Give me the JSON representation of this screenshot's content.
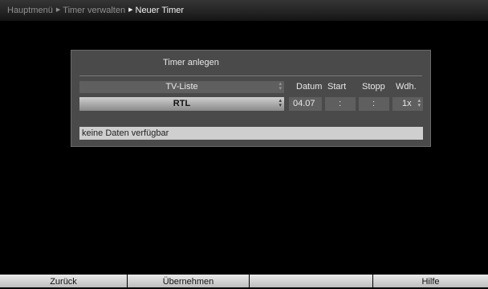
{
  "breadcrumb": {
    "items": [
      "Hauptmenü",
      "Timer verwalten",
      "Neuer Timer"
    ],
    "separator": "▶"
  },
  "dialog": {
    "title": "Timer anlegen",
    "list_label": "TV-Liste",
    "channel": "RTL",
    "updown_icon": "▴▾",
    "columns": {
      "datum": "Datum",
      "start": "Start",
      "stopp": "Stopp",
      "wdh": "Wdh."
    },
    "values": {
      "datum": "04.07",
      "start": ":",
      "stopp": ":",
      "wdh": "1x"
    },
    "info": "keine Daten verfügbar"
  },
  "buttons": {
    "back": "Zurück",
    "apply": "Übernehmen",
    "yellow": "",
    "help": "Hilfe"
  },
  "colors": {
    "background": "#000000",
    "dialog": "#4a4a4a",
    "selected_row": "#b0b0b0",
    "info_bar": "#cfcfcf"
  }
}
